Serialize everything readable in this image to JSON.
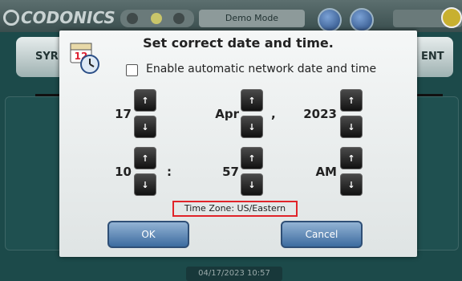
{
  "app": {
    "logo": "CODONICS",
    "mode": "Demo Mode",
    "left_tab_label": "SYR",
    "right_tab_label": "ENT",
    "status_time": "04/17/2023 10:57"
  },
  "dialog": {
    "title": "Set correct date and time.",
    "auto_network_label": "Enable automatic network date and time",
    "calendar_icon_day": "12",
    "day": "17",
    "month": "Apr",
    "comma": ",",
    "year": "2023",
    "hour": "10",
    "colon": ":",
    "minute": "57",
    "ampm": "AM",
    "up_glyph": "↑",
    "down_glyph": "↓",
    "timezone": "Time Zone: US/Eastern",
    "ok_label": "OK",
    "cancel_label": "Cancel"
  },
  "colors": {
    "accent_red": "#e0242a",
    "button_blue": "#3d6ca0"
  }
}
